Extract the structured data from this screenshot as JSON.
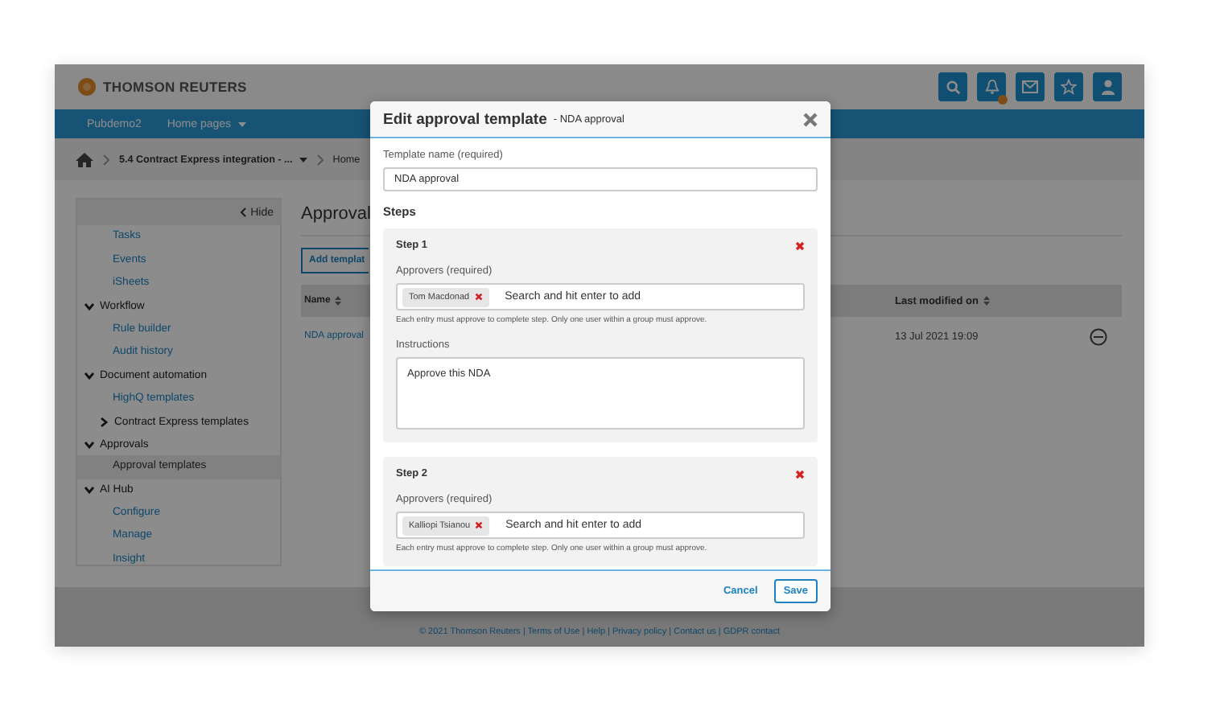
{
  "header": {
    "logo": "THOMSON REUTERS",
    "notification_badge": true
  },
  "nav": [
    {
      "label": "Pubdemo2"
    },
    {
      "label": "Home pages",
      "dropdown": true
    }
  ],
  "breadcrumb": [
    {
      "label": "5.4 Contract Express integration - ...",
      "dropdown": true
    },
    {
      "label": "Home"
    }
  ],
  "sidebar": {
    "hide": "Hide",
    "items": [
      {
        "kind": "link",
        "label": "Tasks",
        "selected": false
      },
      {
        "kind": "link",
        "label": "Events",
        "selected": false
      },
      {
        "kind": "link",
        "label": "iSheets",
        "selected": false
      },
      {
        "kind": "group",
        "label": "Workflow",
        "expanded": true,
        "children": [
          {
            "kind": "link",
            "label": "Rule builder",
            "selected": false
          },
          {
            "kind": "link",
            "label": "Audit history",
            "selected": false
          }
        ]
      },
      {
        "kind": "group",
        "label": "Document automation",
        "expanded": true,
        "children": [
          {
            "kind": "link",
            "label": "HighQ templates",
            "selected": false
          },
          {
            "kind": "group",
            "label": "Contract Express templates",
            "expanded": false
          }
        ]
      },
      {
        "kind": "group",
        "label": "Approvals",
        "expanded": true,
        "children": [
          {
            "kind": "link",
            "label": "Approval templates",
            "selected": true
          }
        ]
      },
      {
        "kind": "group",
        "label": "AI Hub",
        "expanded": true,
        "children": [
          {
            "kind": "link",
            "label": "Configure",
            "selected": false
          },
          {
            "kind": "link",
            "label": "Manage",
            "selected": false
          },
          {
            "kind": "link",
            "label": "Insight",
            "selected": false
          }
        ]
      }
    ]
  },
  "main": {
    "title": "Approval",
    "add_button": "Add templat",
    "columns": [
      "Name",
      "Last modified on"
    ],
    "rows": [
      {
        "name": "NDA approval",
        "modified": "13 Jul 2021 19:09"
      }
    ]
  },
  "footer": "© 2021 Thomson Reuters | Terms of Use | Help | Privacy policy | Contact us | GDPR contact",
  "modal": {
    "title": "Edit approval template",
    "subtitle": "- NDA approval",
    "template_name": {
      "label": "Template name (required)",
      "value": "NDA approval"
    },
    "steps_heading": "Steps",
    "steps": [
      {
        "title": "Step 1",
        "approvers_label": "Approvers (required)",
        "approvers": [
          "Tom Macdonad"
        ],
        "placeholder": "Search and hit enter to add",
        "help": "Each entry must approve to complete step. Only one user within a group must approve.",
        "instructions_label": "Instructions",
        "instructions": "Approve this NDA"
      },
      {
        "title": "Step 2",
        "approvers_label": "Approvers (required)",
        "approvers": [
          "Kalliopi Tsianou"
        ],
        "placeholder": "Search and hit enter to add",
        "help": "Each entry must approve to complete step. Only one user within a group must approve."
      }
    ],
    "cancel": "Cancel",
    "save": "Save"
  }
}
